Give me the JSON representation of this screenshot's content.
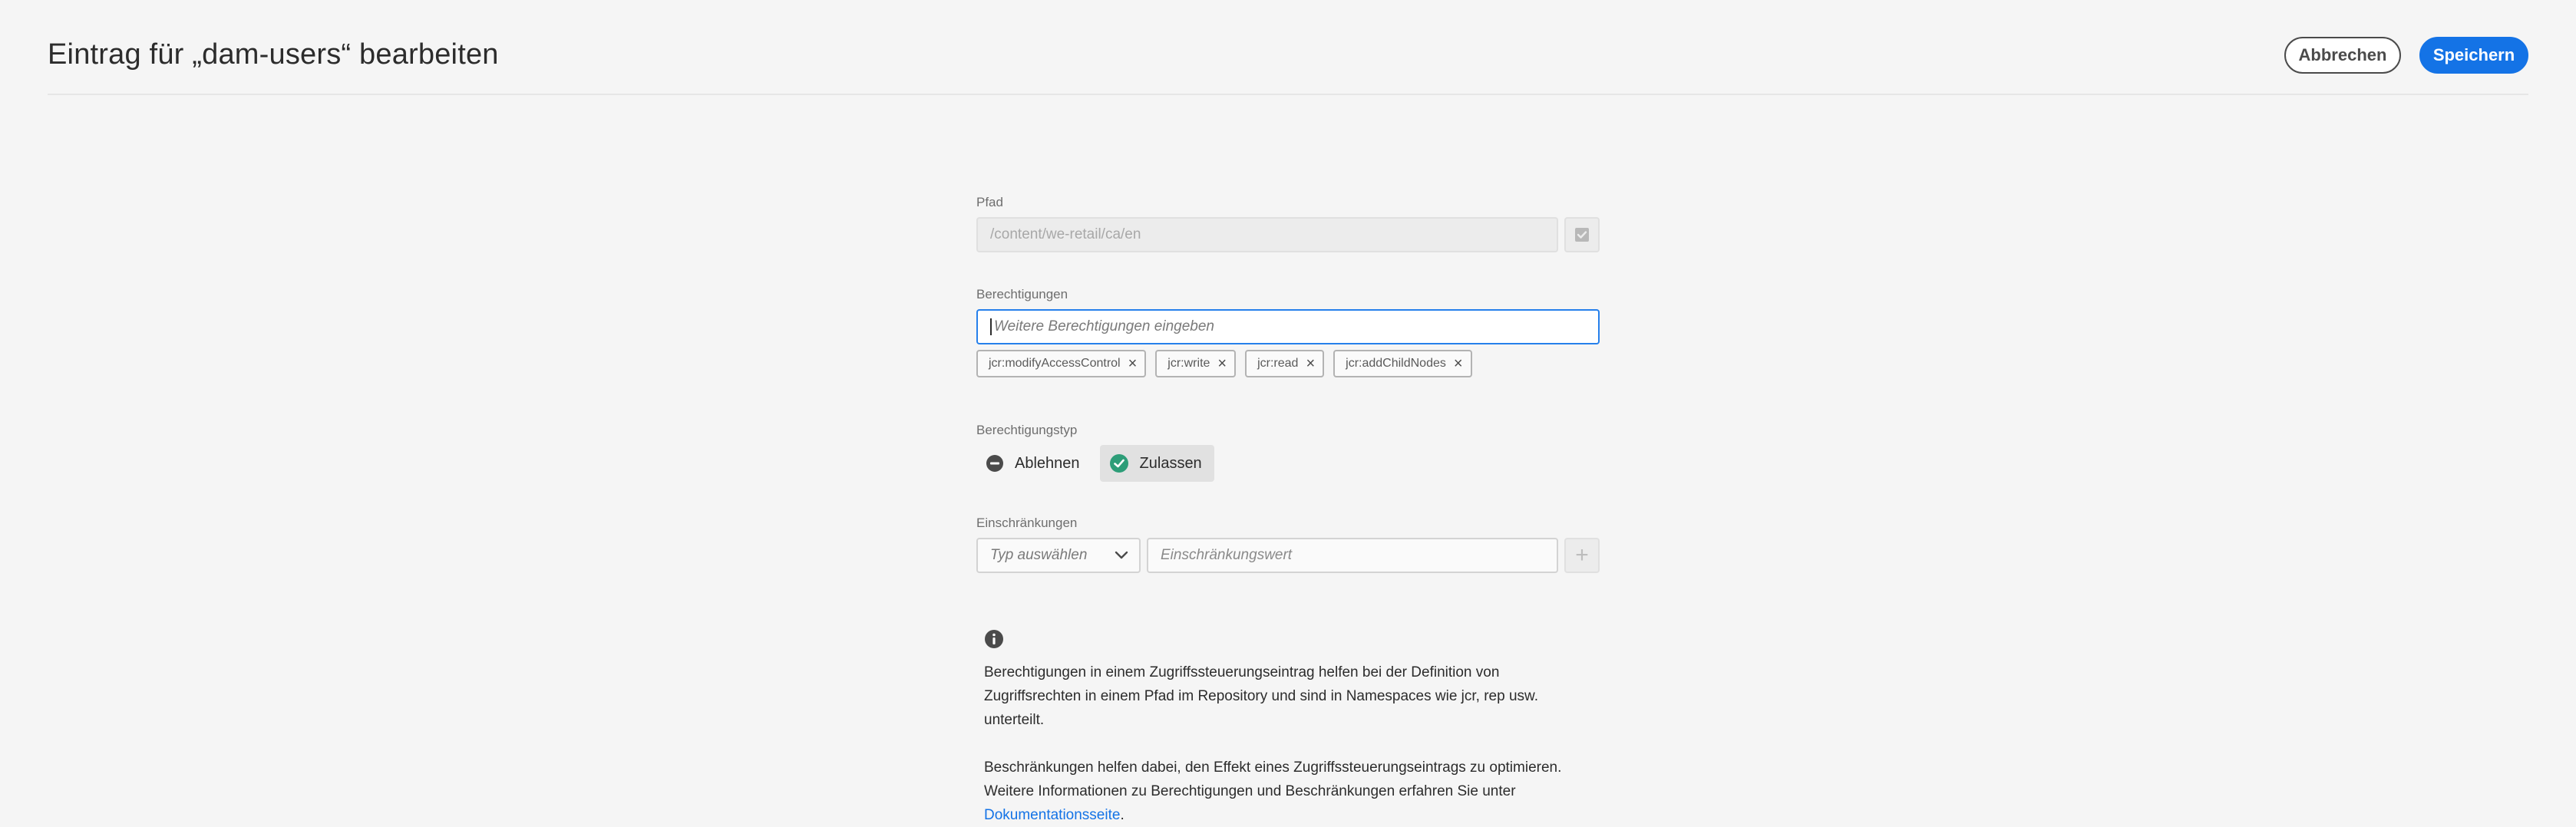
{
  "header": {
    "title": "Eintrag für „dam-users“ bearbeiten",
    "cancel_label": "Abbrechen",
    "save_label": "Speichern"
  },
  "path": {
    "label": "Pfad",
    "value": "/content/we-retail/ca/en"
  },
  "permissions": {
    "label": "Berechtigungen",
    "placeholder": "Weitere Berechtigungen eingeben",
    "tags": [
      "jcr:modifyAccessControl",
      "jcr:write",
      "jcr:read",
      "jcr:addChildNodes"
    ]
  },
  "permission_type": {
    "label": "Berechtigungstyp",
    "deny_label": "Ablehnen",
    "allow_label": "Zulassen",
    "selected": "Zulassen"
  },
  "restrictions": {
    "label": "Einschränkungen",
    "type_placeholder": "Typ auswählen",
    "value_placeholder": "Einschränkungswert"
  },
  "info": {
    "paragraph1": "Berechtigungen in einem Zugriffssteuerungseintrag helfen bei der Definition von Zugriffsrechten in einem Pfad im Repository und sind in Namespaces wie jcr, rep usw. unterteilt.",
    "paragraph2_text": "Beschränkungen helfen dabei, den Effekt eines Zugriffssteuerungseintrags zu optimieren. Weitere Informationen zu Berechtigungen und Beschränkungen erfahren Sie unter",
    "link_text": "Dokumentationsseite",
    "link_suffix": "."
  },
  "colors": {
    "accent": "#1473e6",
    "allow_green": "#2d9d78",
    "deny_gray": "#4b4b4b"
  }
}
